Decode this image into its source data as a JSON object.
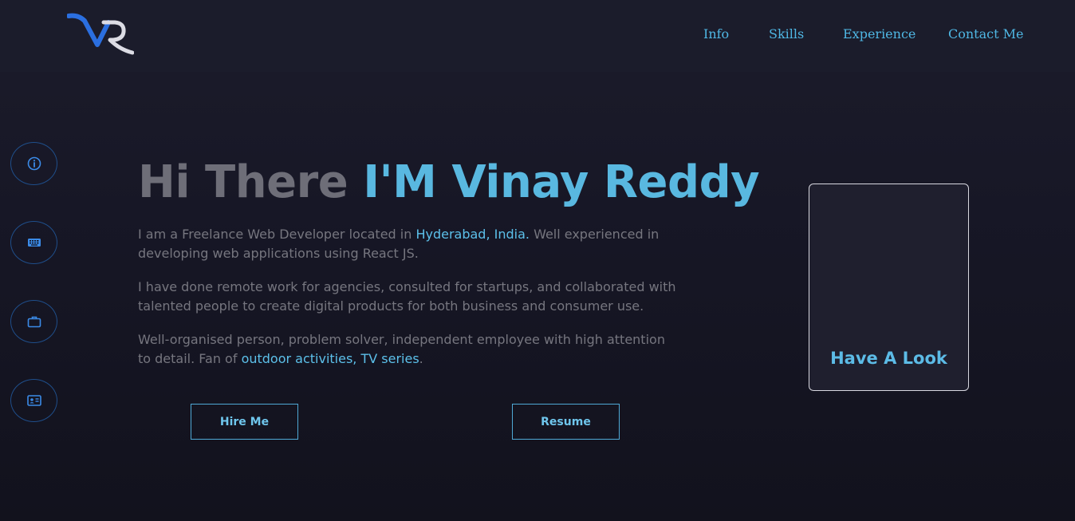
{
  "header": {
    "logo_icon": "vr-logo",
    "nav": [
      {
        "label": "Info"
      },
      {
        "label": "Skills"
      },
      {
        "label": "Experience"
      },
      {
        "label": "Contact Me"
      }
    ]
  },
  "sidebar": {
    "items": [
      {
        "icon": "info-icon"
      },
      {
        "icon": "keyboard-icon"
      },
      {
        "icon": "briefcase-icon"
      },
      {
        "icon": "contact-card-icon"
      }
    ]
  },
  "hero": {
    "greeting": "Hi There ",
    "name": "I'M Vinay Reddy",
    "p1_before": "I am a Freelance Web Developer located in ",
    "p1_highlight": "Hyderabad, India.",
    "p1_after": " Well experienced in developing web applications using React JS.",
    "p2": "I have done remote work for agencies, consulted for startups, and collaborated with talented people to create digital products for both business and consumer use.",
    "p3_before": "Well-organised person, problem solver, independent employee with high attention to detail. Fan of ",
    "p3_highlight": "outdoor activities, TV series",
    "p3_after": "."
  },
  "buttons": {
    "hire": "Hire Me",
    "resume": "Resume"
  },
  "card": {
    "label": "Have A Look"
  },
  "colors": {
    "accent": "#59b8e0",
    "background": "#171726",
    "muted_text": "#76767f"
  }
}
